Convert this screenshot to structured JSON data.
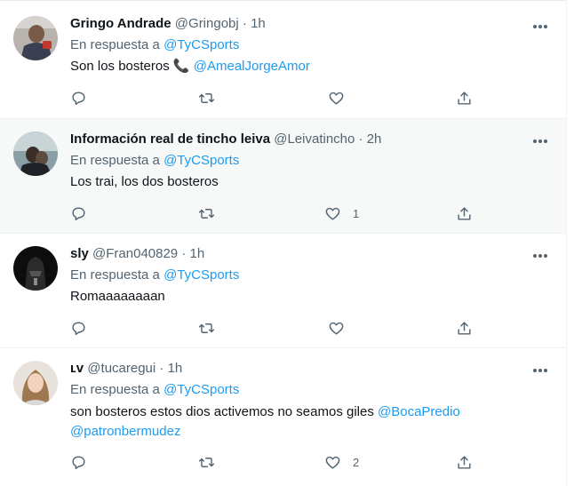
{
  "replies": [
    {
      "name": "Gringo Andrade",
      "handle": "@Gringobj",
      "time": "1h",
      "replying_prefix": "En respuesta a",
      "replying_to": "@TyCSports",
      "text": "Son los bosteros 📞",
      "text_mention": "@AmealJorgeAmor",
      "like_count": ""
    },
    {
      "name": "Información real de tincho leiva",
      "handle": "@Leivatincho",
      "time": "2h",
      "replying_prefix": "En respuesta a",
      "replying_to": "@TyCSports",
      "text": "Los trai, los dos bosteros",
      "like_count": "1"
    },
    {
      "name": "sly",
      "handle": "@Fran040829",
      "time": "1h",
      "replying_prefix": "En respuesta a",
      "replying_to": "@TyCSports",
      "text": "Romaaaaaaaan",
      "like_count": ""
    },
    {
      "name": "ʟv",
      "handle": "@tucaregui",
      "time": "1h",
      "replying_prefix": "En respuesta a",
      "replying_to": "@TyCSports",
      "text": "son bosteros estos dios activemos no seamos giles",
      "text_mention": "@BocaPredio",
      "text_line2": "@patronbermudez",
      "like_count": "2"
    }
  ],
  "separator": "·",
  "colors": {
    "accent": "#1d9bf0",
    "secondary_text": "#536471",
    "highlight_bg": "#f7f9f9"
  },
  "icons": [
    "more-icon",
    "reply-icon",
    "retweet-icon",
    "like-icon",
    "share-icon"
  ]
}
